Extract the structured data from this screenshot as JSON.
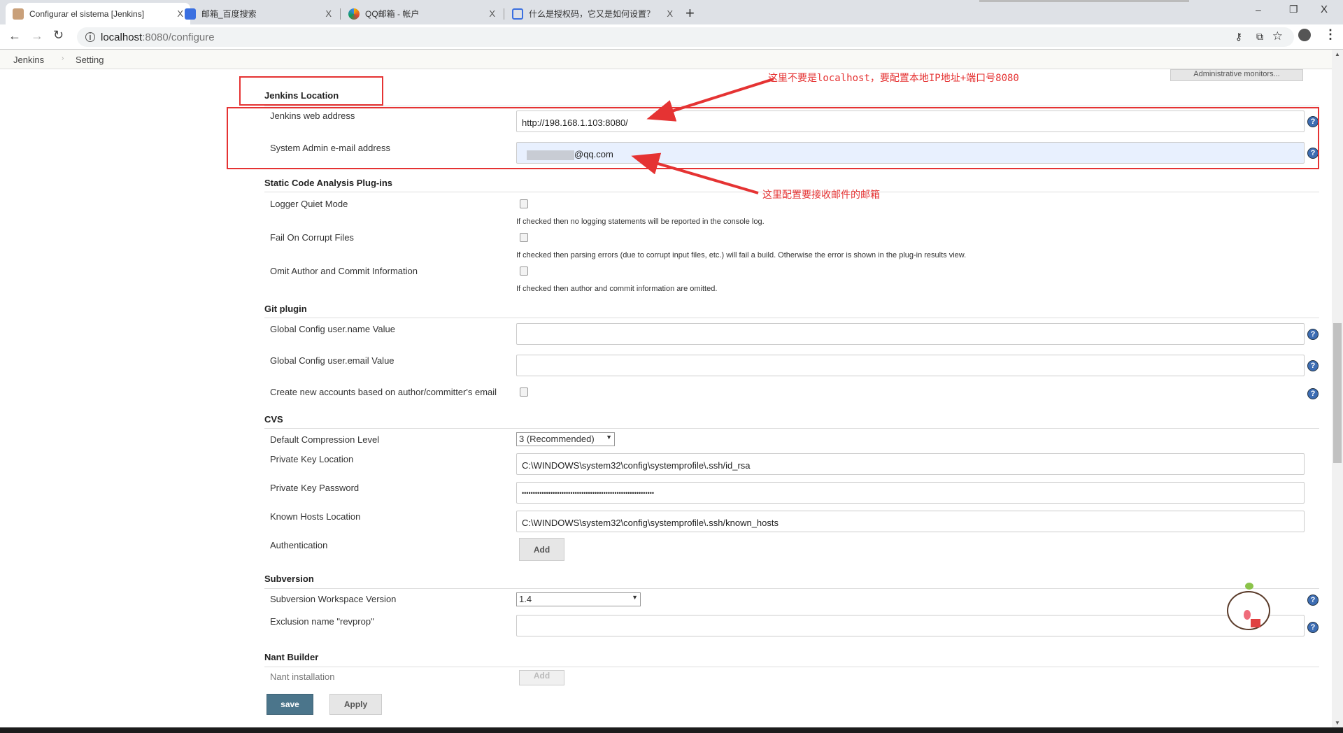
{
  "browser": {
    "tabs": [
      {
        "title": "Configurar el sistema [Jenkins]",
        "icon": "jenkins-icon"
      },
      {
        "title": "邮箱_百度搜索",
        "icon": "baidu-paw-icon"
      },
      {
        "title": "QQ邮箱 - 帐户",
        "icon": "qq-mail-icon"
      },
      {
        "title": "什么是授权码，它又是如何设置？",
        "icon": "qq-help-icon"
      }
    ],
    "close": "X",
    "new_tab": "+",
    "url_host": "localhost",
    "url_rest": ":8080/configure",
    "window_controls": {
      "minimize": "–",
      "restore": "❐",
      "close": "X"
    }
  },
  "breadcrumb": [
    "Jenkins",
    "Setting"
  ],
  "admin_monitors": "Administrative monitors...",
  "sections": {
    "jenkins_location": {
      "title": "Jenkins Location",
      "web_address_label": "Jenkins web address",
      "web_address_value": "http://198.168.1.103:8080/",
      "email_label": "System Admin e-mail address",
      "email_value": "@qq.com"
    },
    "static_code": {
      "title": "Static Code Analysis Plug-ins",
      "items": [
        {
          "label": "Logger Quiet Mode",
          "desc": "If checked then no logging statements will be reported in the console log.",
          "checked": false
        },
        {
          "label": "Fail On Corrupt Files",
          "desc": "If checked then parsing errors (due to corrupt input files, etc.) will fail a build. Otherwise the error is shown in the plug-in results view.",
          "checked": false
        },
        {
          "label": "Omit Author and Commit Information",
          "desc": "If checked then author and commit information are omitted.",
          "checked": false
        }
      ]
    },
    "git": {
      "title": "Git plugin",
      "name_label": "Global Config user.name Value",
      "name_value": "",
      "email_label": "Global Config user.email Value",
      "email_value": "",
      "create_label": "Create new accounts based on author/committer's email",
      "create_checked": false
    },
    "cvs": {
      "title": "CVS",
      "compression_label": "Default Compression Level",
      "compression_value": "3 (Recommended)",
      "key_label": "Private Key Location",
      "key_value": "C:\\WINDOWS\\system32\\config\\systemprofile\\.ssh/id_rsa",
      "pwd_label": "Private Key Password",
      "pwd_value": "••••••••••••••••••••••••••••••••••••••••••••••••••••••••••••",
      "hosts_label": "Known Hosts Location",
      "hosts_value": "C:\\WINDOWS\\system32\\config\\systemprofile\\.ssh/known_hosts",
      "auth_label": "Authentication",
      "add": "Add"
    },
    "subversion": {
      "title": "Subversion",
      "workspace_label": "Subversion Workspace Version",
      "workspace_value": "1.4",
      "exclusion_label": "Exclusion name \"revprop\"",
      "exclusion_value": ""
    },
    "nant": {
      "title": "Nant Builder",
      "install_label": "Nant installation",
      "add": "Add"
    }
  },
  "buttons": {
    "save": "save",
    "apply": "Apply",
    "help": "?"
  },
  "annotations": {
    "note1": "这里不要是localhost，要配置本地IP地址+端口号8080",
    "note2": "这里配置要接收邮件的邮箱",
    "color": "#e53333"
  }
}
